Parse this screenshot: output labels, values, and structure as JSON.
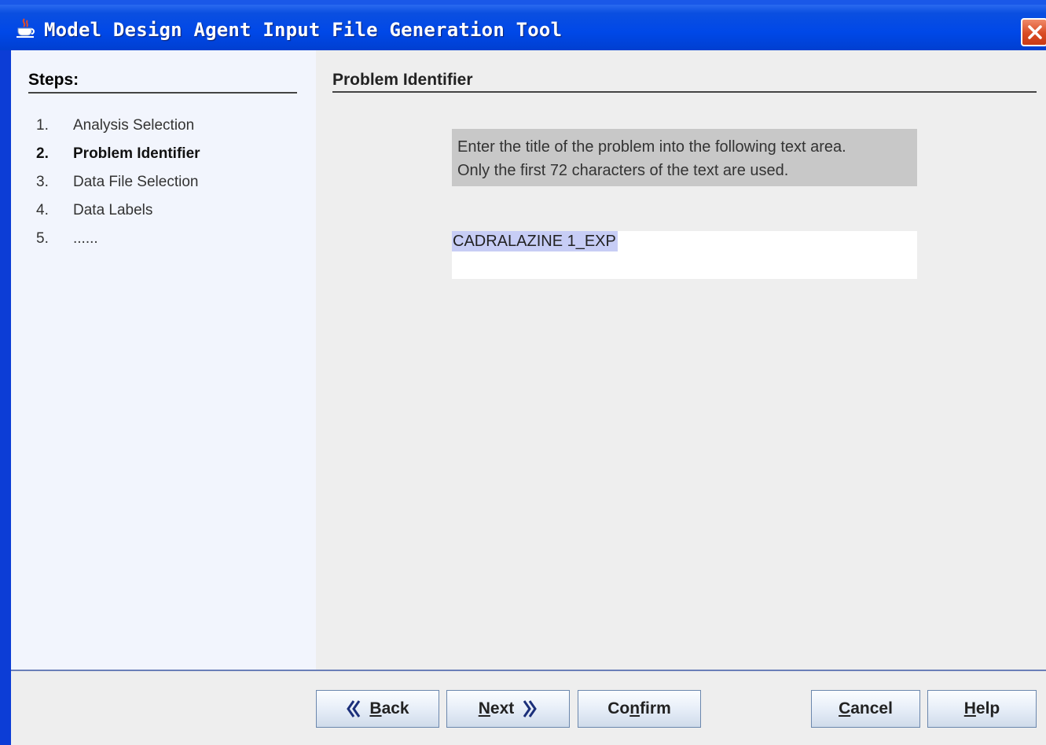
{
  "window": {
    "title": "Model Design Agent Input File Generation Tool"
  },
  "steps": {
    "header": "Steps:",
    "items": [
      {
        "num": "1.",
        "label": "Analysis Selection",
        "active": false
      },
      {
        "num": "2.",
        "label": "Problem Identifier",
        "active": true
      },
      {
        "num": "3.",
        "label": "Data File Selection",
        "active": false
      },
      {
        "num": "4.",
        "label": "Data Labels",
        "active": false
      },
      {
        "num": "5.",
        "label": "......",
        "active": false
      }
    ]
  },
  "main": {
    "title": "Problem Identifier",
    "info_line1": "Enter the title of the problem into the following text area.",
    "info_line2": "Only the first 72 characters of the text are used.",
    "text_value": "CADRALAZINE 1_EXP"
  },
  "buttons": {
    "back": {
      "mnemonic": "B",
      "rest": "ack"
    },
    "next": {
      "mnemonic": "N",
      "rest": "ext"
    },
    "confirm": {
      "pre": "Co",
      "mnemonic": "n",
      "rest": "firm"
    },
    "cancel": {
      "mnemonic": "C",
      "rest": "ancel"
    },
    "help": {
      "mnemonic": "H",
      "rest": "elp"
    }
  },
  "colors": {
    "titlebar": "#0048e8",
    "close": "#d94b24",
    "selection": "#c7cdf5"
  },
  "icons": [
    "java-cup-icon",
    "close-x-icon",
    "chevron-left-icon",
    "chevron-right-icon"
  ]
}
